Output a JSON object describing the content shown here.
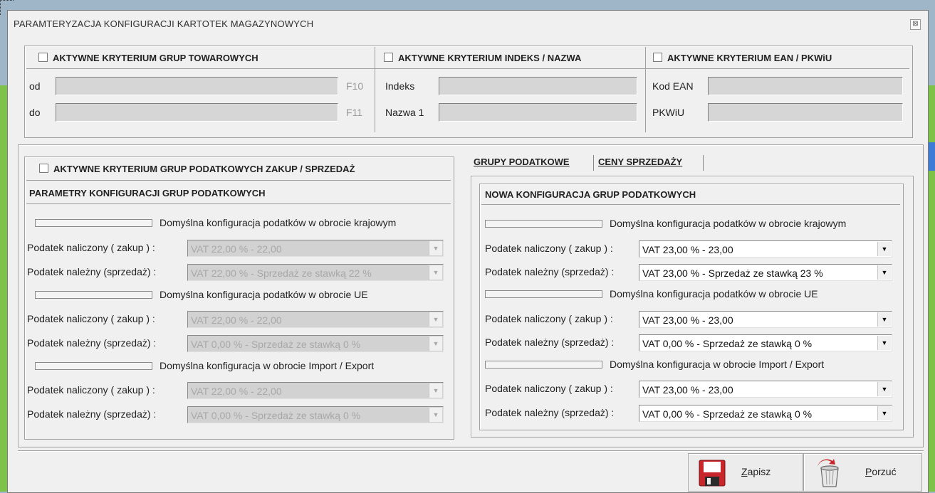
{
  "window": {
    "title": "PARAMTERYZACJA  KONFIGURACJI KARTOTEK MAGAZYNOWYCH",
    "close_glyph": "⊠"
  },
  "top": {
    "groups": {
      "header": "AKTYWNE KRYTERIUM GRUP TOWAROWYCH",
      "od_label": "od",
      "do_label": "do",
      "f10": "F10",
      "f11": "F11",
      "od_value": "",
      "do_value": ""
    },
    "index": {
      "header": "AKTYWNE KRYTERIUM  INDEKS / NAZWA",
      "indeks_label": "Indeks",
      "nazwa_label": "Nazwa 1",
      "indeks_value": "",
      "nazwa_value": ""
    },
    "ean": {
      "header": "AKTYWNE KRYTERIUM EAN / PKWiU",
      "ean_label": "Kod EAN",
      "pkwiu_label": "PKWiU",
      "ean_value": "",
      "pkwiu_value": ""
    }
  },
  "left": {
    "active_header": "AKTYWNE KRYTERIUM GRUP PODATKOWYCH ZAKUP / SPRZEDAŻ",
    "params_header": "PARAMETRY KONFIGURACJI GRUP PODATKOWYCH",
    "sections": [
      {
        "title": "Domyślna konfiguracja podatków w obrocie krajowym",
        "purchase_label": "Podatek naliczony ( zakup ) :",
        "purchase_value": "VAT 22,00 % - 22,00",
        "sale_label": "Podatek należny (sprzedaż) :",
        "sale_value": "VAT 22,00 % - Sprzedaż ze stawką 22 %"
      },
      {
        "title": "Domyślna konfiguracja podatków w obrocie UE",
        "purchase_label": "Podatek naliczony ( zakup ) :",
        "purchase_value": "VAT 22,00 % - 22,00",
        "sale_label": "Podatek należny (sprzedaż) :",
        "sale_value": "VAT 0,00 % - Sprzedaż ze stawką 0 %"
      },
      {
        "title": "Domyślna konfiguracja w obrocie Import / Export",
        "purchase_label": "Podatek naliczony ( zakup ) :",
        "purchase_value": "VAT 22,00 % - 22,00",
        "sale_label": "Podatek należny (sprzedaż) :",
        "sale_value": "VAT 0,00 % - Sprzedaż ze stawką 0 %"
      }
    ]
  },
  "right": {
    "tabs": [
      "GRUPY PODATKOWE",
      "CENY SPRZEDAŻY"
    ],
    "header": "NOWA KONFIGURACJA GRUP PODATKOWYCH",
    "sections": [
      {
        "title": "Domyślna konfiguracja podatków w obrocie krajowym",
        "purchase_label": "Podatek naliczony ( zakup ) :",
        "purchase_value": "VAT 23,00 % - 23,00",
        "sale_label": "Podatek należny (sprzedaż) :",
        "sale_value": "VAT 23,00 % - Sprzedaż ze stawką 23 %"
      },
      {
        "title": "Domyślna konfiguracja podatków w obrocie UE",
        "purchase_label": "Podatek naliczony ( zakup ) :",
        "purchase_value": "VAT 23,00 % - 23,00",
        "sale_label": "Podatek należny (sprzedaż) :",
        "sale_value": "VAT 0,00 % - Sprzedaż ze stawką 0 %"
      },
      {
        "title": "Domyślna konfiguracja w obrocie Import / Export",
        "purchase_label": "Podatek naliczony ( zakup ) :",
        "purchase_value": "VAT 23,00 % - 23,00",
        "sale_label": "Podatek należny (sprzedaż) :",
        "sale_value": "VAT 0,00 % - Sprzedaż ze stawką 0 %"
      }
    ]
  },
  "buttons": {
    "save_accel": "Z",
    "save_rest": "apisz",
    "cancel_accel": "P",
    "cancel_rest": "orzuć"
  },
  "icons": {
    "save": "floppy-disk-icon",
    "cancel": "recycle-bin-icon",
    "dropdown": "▼",
    "dropdown_disabled": "▼"
  },
  "colors": {
    "window_bg": "#f0f0f0",
    "disabled_field": "#d2d2d2",
    "floppy_red": "#c8262a"
  }
}
